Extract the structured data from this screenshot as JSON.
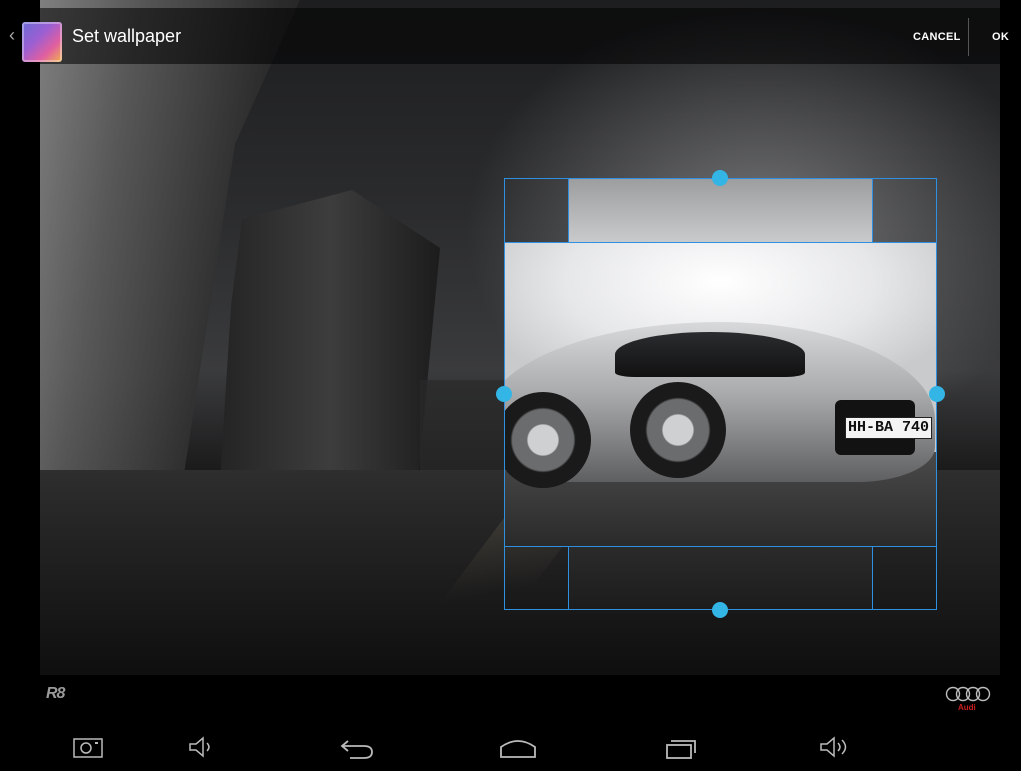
{
  "action_bar": {
    "title": "Set wallpaper",
    "cancel_label": "CANCEL",
    "ok_label": "OK"
  },
  "wallpaper": {
    "car_plate": "HH-BA 740",
    "logo_left": "R8",
    "logo_right": "Audi"
  },
  "colors": {
    "crop_frame": "#2f8fe0",
    "handle": "#33b5e5"
  },
  "nav_bar": {
    "icons": [
      "camera-icon",
      "volume-down-icon",
      "back-icon",
      "home-icon",
      "recent-apps-icon",
      "volume-up-icon"
    ]
  }
}
